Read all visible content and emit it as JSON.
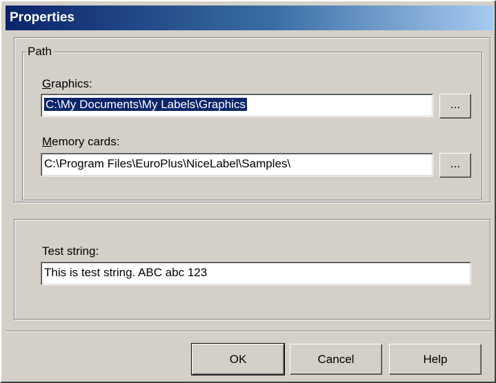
{
  "window": {
    "title": "Properties"
  },
  "path_group": {
    "legend": "Path",
    "graphics": {
      "label": "Graphics:",
      "value": "C:\\My Documents\\My Labels\\Graphics",
      "browse": "..."
    },
    "memory_cards": {
      "label": "Memory cards:",
      "value": "C:\\Program Files\\EuroPlus\\NiceLabel\\Samples\\",
      "browse": "..."
    }
  },
  "test_group": {
    "label": "Test string:",
    "value": "This is test string. ABC abc 123"
  },
  "buttons": {
    "ok": "OK",
    "cancel": "Cancel",
    "help": "Help"
  },
  "colors": {
    "title_start": "#0a246a",
    "title_end": "#a6caf0",
    "face": "#d4d0c8",
    "selection": "#0a246a"
  }
}
